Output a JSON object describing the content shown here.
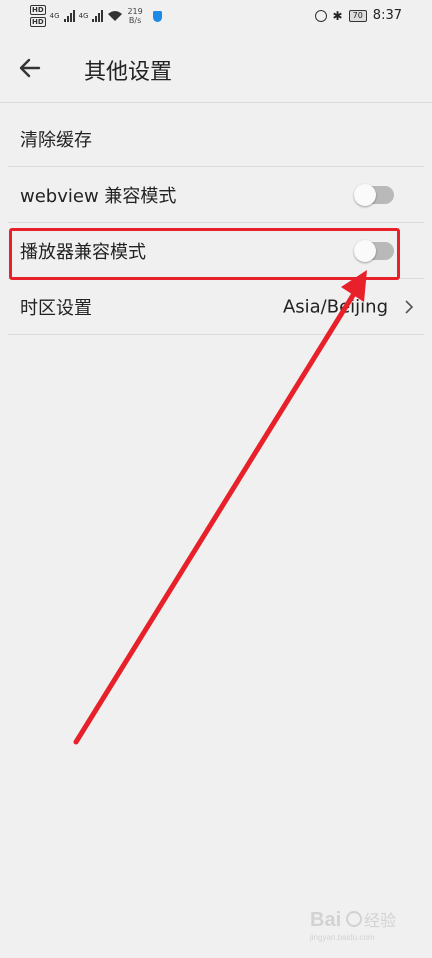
{
  "status_bar": {
    "left_badges": [
      "HD",
      "HD"
    ],
    "network_labels": [
      "4G",
      "4G"
    ],
    "speed_value": "219",
    "speed_unit": "B/s",
    "battery": "70",
    "time": "8:37"
  },
  "header": {
    "title": "其他设置"
  },
  "settings": [
    {
      "label": "清除缓存"
    },
    {
      "label": "webview 兼容模式",
      "toggle_on": false
    },
    {
      "label": "播放器兼容模式",
      "toggle_on": false
    },
    {
      "label": "时区设置",
      "value": "Asia/Beijing"
    }
  ],
  "colors": {
    "annotation": "#e8202a",
    "background": "#f0f0f0",
    "toggle_track": "#b9b9b9"
  },
  "icons": {
    "back": "arrow-left-icon",
    "chevron": "chevron-right-icon",
    "watermark": "baidu-jingyan-logo"
  },
  "watermark": {
    "text": "Bai 经验",
    "subtext": "jingyan.baidu.com"
  }
}
